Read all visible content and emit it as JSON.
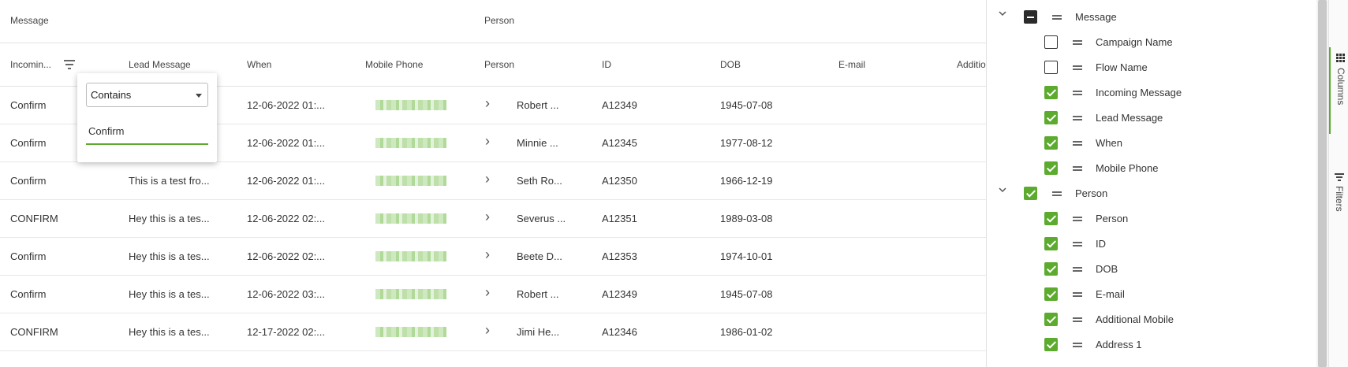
{
  "grid": {
    "group_headers": [
      "Message",
      "Person"
    ],
    "column_headers": [
      "Incomin...",
      "Lead Message",
      "When",
      "Mobile Phone",
      "Person",
      "ID",
      "DOB",
      "E-mail",
      "Additio"
    ],
    "rows": [
      {
        "incoming": "Confirm",
        "lead": "",
        "when": "12-06-2022 01:...",
        "person": "Robert ...",
        "id": "A12349",
        "dob": "1945-07-08"
      },
      {
        "incoming": "Confirm",
        "lead": "",
        "when": "12-06-2022 01:...",
        "person": "Minnie ...",
        "id": "A12345",
        "dob": "1977-08-12"
      },
      {
        "incoming": "Confirm",
        "lead": "This is a test fro...",
        "when": "12-06-2022 01:...",
        "person": "Seth Ro...",
        "id": "A12350",
        "dob": "1966-12-19"
      },
      {
        "incoming": "CONFIRM",
        "lead": "Hey this is a tes...",
        "when": "12-06-2022 02:...",
        "person": "Severus ...",
        "id": "A12351",
        "dob": "1989-03-08"
      },
      {
        "incoming": "Confirm",
        "lead": "Hey this is a tes...",
        "when": "12-06-2022 02:...",
        "person": "Beete D...",
        "id": "A12353",
        "dob": "1974-10-01"
      },
      {
        "incoming": "Confirm",
        "lead": "Hey this is a tes...",
        "when": "12-06-2022 03:...",
        "person": "Robert ...",
        "id": "A12349",
        "dob": "1945-07-08"
      },
      {
        "incoming": "CONFIRM",
        "lead": "Hey this is a tes...",
        "when": "12-17-2022 02:...",
        "person": "Jimi He...",
        "id": "A12346",
        "dob": "1986-01-02"
      }
    ]
  },
  "filter_popup": {
    "operator": "Contains",
    "value": "Confirm"
  },
  "columns_panel": {
    "items": [
      {
        "label": "Message",
        "level": 0,
        "state": "indeterminate",
        "group": true
      },
      {
        "label": "Campaign Name",
        "level": 1,
        "state": "unchecked"
      },
      {
        "label": "Flow Name",
        "level": 1,
        "state": "unchecked"
      },
      {
        "label": "Incoming Message",
        "level": 1,
        "state": "checked"
      },
      {
        "label": "Lead Message",
        "level": 1,
        "state": "checked"
      },
      {
        "label": "When",
        "level": 1,
        "state": "checked"
      },
      {
        "label": "Mobile Phone",
        "level": 1,
        "state": "checked"
      },
      {
        "label": "Person",
        "level": 0,
        "state": "checked",
        "group": true
      },
      {
        "label": "Person",
        "level": 1,
        "state": "checked"
      },
      {
        "label": "ID",
        "level": 1,
        "state": "checked"
      },
      {
        "label": "DOB",
        "level": 1,
        "state": "checked"
      },
      {
        "label": "E-mail",
        "level": 1,
        "state": "checked"
      },
      {
        "label": "Additional Mobile",
        "level": 1,
        "state": "checked"
      },
      {
        "label": "Address 1",
        "level": 1,
        "state": "checked"
      }
    ]
  },
  "side_tabs": {
    "columns": "Columns",
    "filters": "Filters"
  },
  "colors": {
    "accent": "#5cab2f",
    "checkbox_dark": "#2b2b2b"
  },
  "icons": [
    "filter-icon",
    "chevron-right-icon",
    "chevron-down-icon",
    "drag-handle-icon",
    "columns-grid-icon",
    "filter-tab-icon",
    "dropdown-caret-icon"
  ]
}
